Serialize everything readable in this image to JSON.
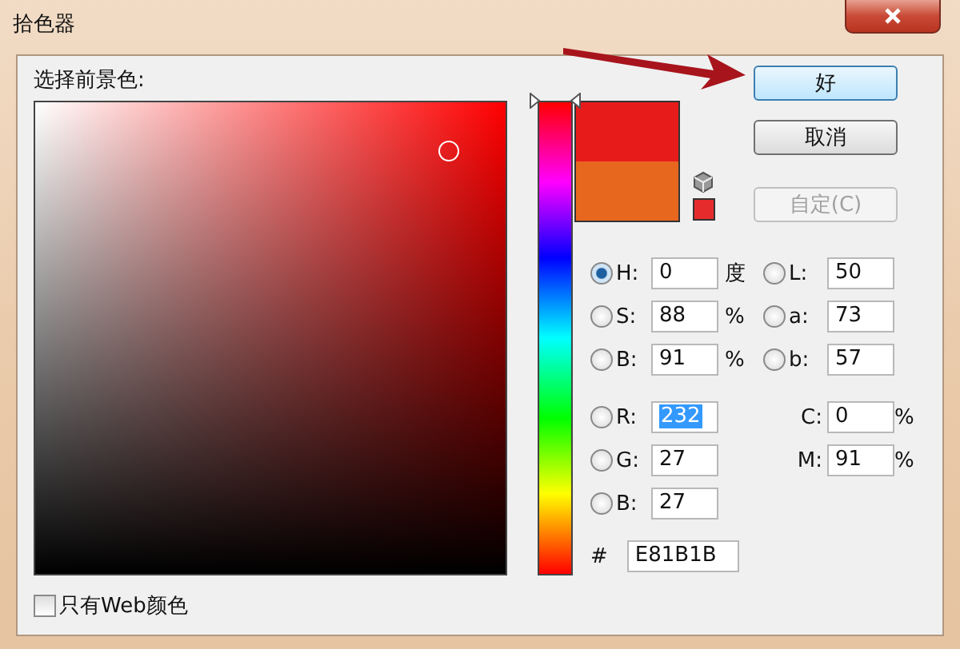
{
  "window": {
    "title": "拾色器"
  },
  "picker_label": "选择前景色:",
  "buttons": [
    {
      "label": "好",
      "disabled": false
    },
    {
      "label": "取消",
      "disabled": false
    },
    {
      "label": "自定(C)",
      "disabled": true
    }
  ],
  "hsb": [
    {
      "label": "H:",
      "value": "0",
      "unit": "度",
      "selected": true
    },
    {
      "label": "S:",
      "value": "88",
      "unit": "%",
      "selected": false
    },
    {
      "label": "B:",
      "value": "91",
      "unit": "%",
      "selected": false
    }
  ],
  "lab": [
    {
      "label": "L:",
      "value": "50",
      "selected": false
    },
    {
      "label": "a:",
      "value": "73",
      "selected": false
    },
    {
      "label": "b:",
      "value": "57",
      "selected": false
    }
  ],
  "rgb": [
    {
      "label": "R:",
      "value": "232",
      "selected": false,
      "highlighted": true
    },
    {
      "label": "G:",
      "value": "27",
      "selected": false,
      "highlighted": false
    },
    {
      "label": "B:",
      "value": "27",
      "selected": false,
      "highlighted": false
    }
  ],
  "cmyk": [
    {
      "label": "C:",
      "value": "0",
      "unit": "%"
    },
    {
      "label": "M:",
      "value": "91",
      "unit": "%"
    }
  ],
  "hex": {
    "label": "#",
    "value": "E81B1B"
  },
  "web_only": {
    "label": "只有Web颜色",
    "checked": false
  }
}
